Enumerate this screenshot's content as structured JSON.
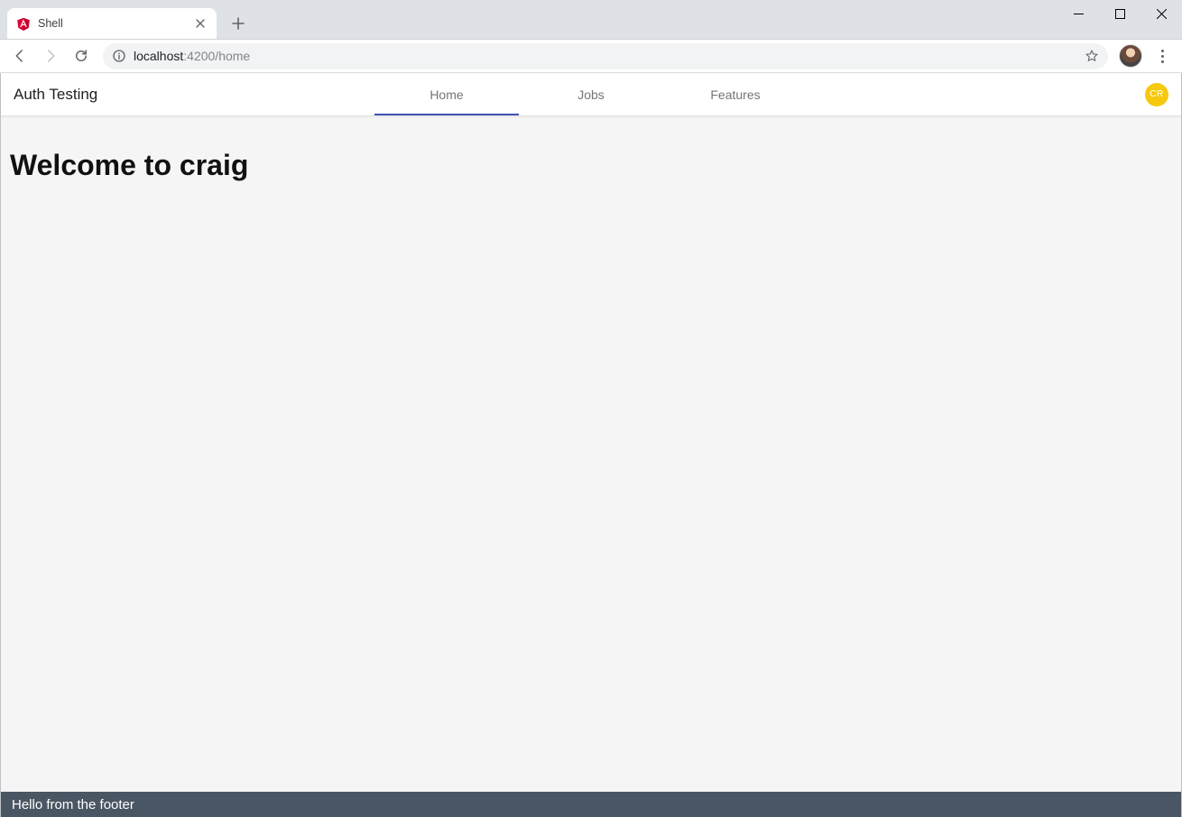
{
  "browser": {
    "tab_title": "Shell",
    "url_host": "localhost",
    "url_rest": ":4200/home"
  },
  "header": {
    "brand": "Auth Testing",
    "tabs": [
      {
        "label": "Home",
        "active": true
      },
      {
        "label": "Jobs",
        "active": false
      },
      {
        "label": "Features",
        "active": false
      }
    ],
    "user_initials": "CR"
  },
  "main": {
    "heading": "Welcome to craig"
  },
  "footer": {
    "text": "Hello from the footer"
  }
}
